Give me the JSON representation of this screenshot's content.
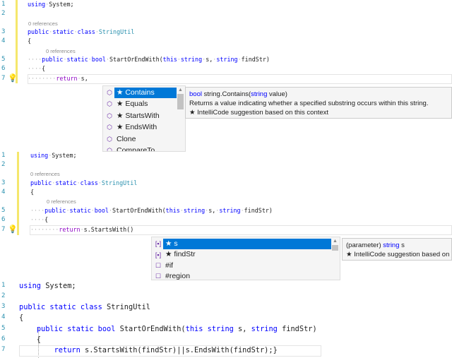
{
  "colors": {
    "keyword": "#0000ff",
    "type": "#2b91af",
    "control": "#8f08c4",
    "selection": "#0078d7",
    "change_bar": "#f5e76c"
  },
  "panel1": {
    "lines": [
      {
        "num": "1",
        "tokens": [
          {
            "t": "using",
            "c": "k"
          },
          {
            "t": "·",
            "c": "w"
          },
          {
            "t": "System;",
            "c": "t"
          }
        ]
      },
      {
        "num": "2",
        "tokens": []
      },
      {
        "num": "3",
        "tokens": [
          {
            "t": "public",
            "c": "k"
          },
          {
            "t": "·",
            "c": "w"
          },
          {
            "t": "static",
            "c": "k"
          },
          {
            "t": "·",
            "c": "w"
          },
          {
            "t": "class",
            "c": "k"
          },
          {
            "t": "·",
            "c": "w"
          },
          {
            "t": "StringUtil",
            "c": "c"
          }
        ]
      },
      {
        "num": "4",
        "tokens": [
          {
            "t": "{",
            "c": "t"
          }
        ]
      },
      {
        "num": "5",
        "tokens": [
          {
            "t": "····",
            "c": "w"
          },
          {
            "t": "public",
            "c": "k"
          },
          {
            "t": "·",
            "c": "w"
          },
          {
            "t": "static",
            "c": "k"
          },
          {
            "t": "·",
            "c": "w"
          },
          {
            "t": "bool",
            "c": "k"
          },
          {
            "t": "·",
            "c": "w"
          },
          {
            "t": "StartOrEndWith(",
            "c": "m"
          },
          {
            "t": "this",
            "c": "k"
          },
          {
            "t": "·",
            "c": "w"
          },
          {
            "t": "string",
            "c": "k"
          },
          {
            "t": "·",
            "c": "w"
          },
          {
            "t": "s,",
            "c": "t"
          },
          {
            "t": "·",
            "c": "w"
          },
          {
            "t": "string",
            "c": "k"
          },
          {
            "t": "·",
            "c": "w"
          },
          {
            "t": "findStr)",
            "c": "t"
          }
        ]
      },
      {
        "num": "6",
        "tokens": [
          {
            "t": "····",
            "c": "w"
          },
          {
            "t": "{",
            "c": "t"
          }
        ]
      },
      {
        "num": "7",
        "tokens": [
          {
            "t": "········",
            "c": "w"
          },
          {
            "t": "return",
            "c": "r"
          },
          {
            "t": "·",
            "c": "w"
          },
          {
            "t": "s,",
            "c": "t"
          }
        ]
      }
    ],
    "refs": [
      "0 references",
      "0 references"
    ],
    "completion": [
      {
        "label": "★ Contains",
        "icon": "method-icon",
        "selected": true
      },
      {
        "label": "★ Equals",
        "icon": "method-icon"
      },
      {
        "label": "★ StartsWith",
        "icon": "method-icon"
      },
      {
        "label": "★ EndsWith",
        "icon": "method-icon"
      },
      {
        "label": "Clone",
        "icon": "method-icon"
      },
      {
        "label": "CompareTo",
        "icon": "method-icon"
      }
    ],
    "tooltip": {
      "sig_type": "bool",
      "sig_rest": " string.Contains(",
      "sig_ptype": "string",
      "sig_pname": " value)",
      "desc": "Returns a value indicating whether a specified substring occurs within this string.",
      "note": "★  IntelliCode suggestion based on this context"
    }
  },
  "panel2": {
    "lines": [
      {
        "num": "1",
        "tokens": [
          {
            "t": "using",
            "c": "k"
          },
          {
            "t": "·",
            "c": "w"
          },
          {
            "t": "System;",
            "c": "t"
          }
        ]
      },
      {
        "num": "2",
        "tokens": []
      },
      {
        "num": "3",
        "tokens": [
          {
            "t": "public",
            "c": "k"
          },
          {
            "t": "·",
            "c": "w"
          },
          {
            "t": "static",
            "c": "k"
          },
          {
            "t": "·",
            "c": "w"
          },
          {
            "t": "class",
            "c": "k"
          },
          {
            "t": "·",
            "c": "w"
          },
          {
            "t": "StringUtil",
            "c": "c"
          }
        ]
      },
      {
        "num": "4",
        "tokens": [
          {
            "t": "{",
            "c": "t"
          }
        ]
      },
      {
        "num": "5",
        "tokens": [
          {
            "t": "····",
            "c": "w"
          },
          {
            "t": "public",
            "c": "k"
          },
          {
            "t": "·",
            "c": "w"
          },
          {
            "t": "static",
            "c": "k"
          },
          {
            "t": "·",
            "c": "w"
          },
          {
            "t": "bool",
            "c": "k"
          },
          {
            "t": "·",
            "c": "w"
          },
          {
            "t": "StartOrEndWith(",
            "c": "m"
          },
          {
            "t": "this",
            "c": "k"
          },
          {
            "t": "·",
            "c": "w"
          },
          {
            "t": "string",
            "c": "k"
          },
          {
            "t": "·",
            "c": "w"
          },
          {
            "t": "s,",
            "c": "t"
          },
          {
            "t": "·",
            "c": "w"
          },
          {
            "t": "string",
            "c": "k"
          },
          {
            "t": "·",
            "c": "w"
          },
          {
            "t": "findStr)",
            "c": "t"
          }
        ]
      },
      {
        "num": "6",
        "tokens": [
          {
            "t": "····",
            "c": "w"
          },
          {
            "t": "{",
            "c": "t"
          }
        ]
      },
      {
        "num": "7",
        "tokens": [
          {
            "t": "········",
            "c": "w"
          },
          {
            "t": "return",
            "c": "r"
          },
          {
            "t": "·",
            "c": "w"
          },
          {
            "t": "s.StartsWith()",
            "c": "t"
          }
        ]
      }
    ],
    "refs": [
      "0 references",
      "0 references"
    ],
    "completion": [
      {
        "label": "★ s",
        "icon": "parameter-icon",
        "selected": true
      },
      {
        "label": "★ findStr",
        "icon": "parameter-icon"
      },
      {
        "label": "#if",
        "icon": "snippet-icon"
      },
      {
        "label": "#region",
        "icon": "snippet-icon"
      }
    ],
    "tooltip": {
      "sig_pre": "(parameter) ",
      "sig_type": "string",
      "sig_rest": " s",
      "note": "★  IntelliCode suggestion based on this context"
    }
  },
  "panel3": {
    "lines": [
      {
        "num": "1",
        "tokens": [
          {
            "t": "using",
            "c": "k"
          },
          {
            "t": " System;",
            "c": "t"
          }
        ]
      },
      {
        "num": "2",
        "tokens": []
      },
      {
        "num": "3",
        "tokens": [
          {
            "t": "public",
            "c": "k"
          },
          {
            "t": " ",
            "c": "t"
          },
          {
            "t": "static",
            "c": "k"
          },
          {
            "t": " ",
            "c": "t"
          },
          {
            "t": "class",
            "c": "k"
          },
          {
            "t": " StringUtil",
            "c": "t"
          }
        ]
      },
      {
        "num": "4",
        "tokens": [
          {
            "t": "{",
            "c": "t"
          }
        ]
      },
      {
        "num": "5",
        "tokens": [
          {
            "t": "    ",
            "c": "t"
          },
          {
            "t": "public",
            "c": "k"
          },
          {
            "t": " ",
            "c": "t"
          },
          {
            "t": "static",
            "c": "k"
          },
          {
            "t": " ",
            "c": "t"
          },
          {
            "t": "bool",
            "c": "k"
          },
          {
            "t": " StartOrEndWith(",
            "c": "t"
          },
          {
            "t": "this",
            "c": "k"
          },
          {
            "t": " ",
            "c": "t"
          },
          {
            "t": "string",
            "c": "k"
          },
          {
            "t": " s, ",
            "c": "t"
          },
          {
            "t": "string",
            "c": "k"
          },
          {
            "t": " findStr)",
            "c": "t"
          }
        ]
      },
      {
        "num": "6",
        "tokens": [
          {
            "t": "    {",
            "c": "t"
          }
        ]
      },
      {
        "num": "7",
        "tokens": [
          {
            "t": "        ",
            "c": "t"
          },
          {
            "t": "return",
            "c": "k"
          },
          {
            "t": " s.StartsWith(findStr)||s.EndsWith(findStr);}",
            "c": "t"
          }
        ]
      }
    ]
  }
}
